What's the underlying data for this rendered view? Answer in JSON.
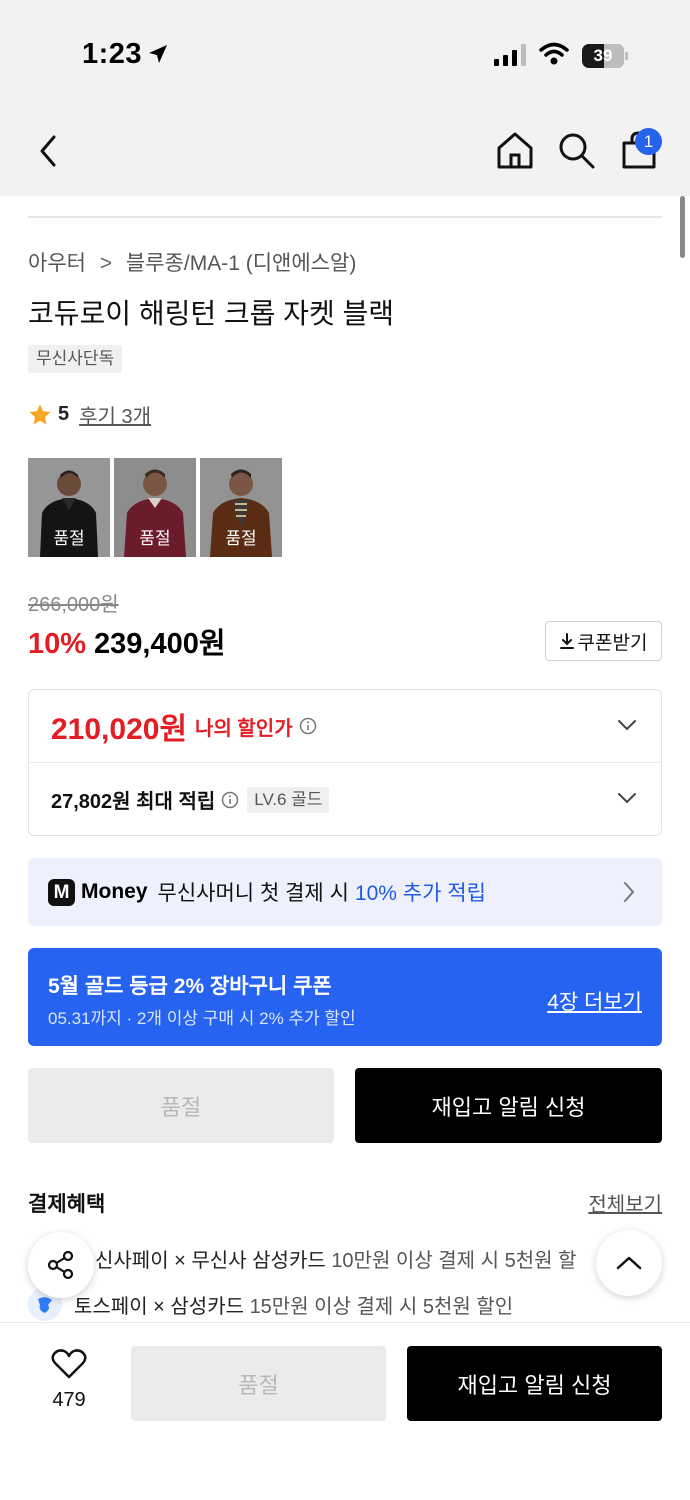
{
  "status_bar": {
    "time": "1:23",
    "battery": "39"
  },
  "header": {
    "cart_count": "1"
  },
  "breadcrumb": {
    "category": "아우터",
    "separator": ">",
    "subcategory": "블루종/MA-1 (디앤에스알)"
  },
  "product": {
    "title": "코듀로이 해링턴 크롭 자켓 블랙",
    "tag": "무신사단독",
    "rating": "5",
    "review_link": "후기 3개",
    "thumbnails": [
      {
        "label": "품절",
        "color": "black"
      },
      {
        "label": "품절",
        "color": "burgundy"
      },
      {
        "label": "품절",
        "color": "brown"
      }
    ],
    "original_price": "266,000원",
    "discount_rate": "10%",
    "sale_price": "239,400원",
    "coupon_button": "쿠폰받기"
  },
  "benefits": {
    "my_price": "210,020원",
    "my_price_label": "나의 할인가",
    "points": "27,802원 최대 적립",
    "level_badge": "LV.6 골드"
  },
  "money_banner": {
    "logo": "M",
    "brand": "Money",
    "text": "무신사머니 첫 결제 시",
    "highlight": "10% 추가 적립"
  },
  "coupon_banner": {
    "title": "5월 골드 등급 2% 장바구니 쿠폰",
    "subtitle": "05.31까지 · 2개 이상 구매 시 2% 추가 할인",
    "link": "4장 더보기"
  },
  "actions": {
    "soldout": "품절",
    "restock": "재입고 알림 신청"
  },
  "payment_benefits": {
    "title": "결제혜택",
    "see_all": "전체보기",
    "items": [
      {
        "name": "신사페이 × 무신사 삼성카드",
        "detail": "10만원 이상 결제 시 5천원 할"
      },
      {
        "name": "토스페이 × 삼성카드",
        "detail": "15만원 이상 결제 시 5천원 할인"
      }
    ]
  },
  "bottom_bar": {
    "like_count": "479",
    "soldout": "품절",
    "restock": "재입고 알림 신청"
  },
  "colors": {
    "accent_red": "#e51c23",
    "accent_blue": "#2563f0",
    "black": "#000000"
  }
}
